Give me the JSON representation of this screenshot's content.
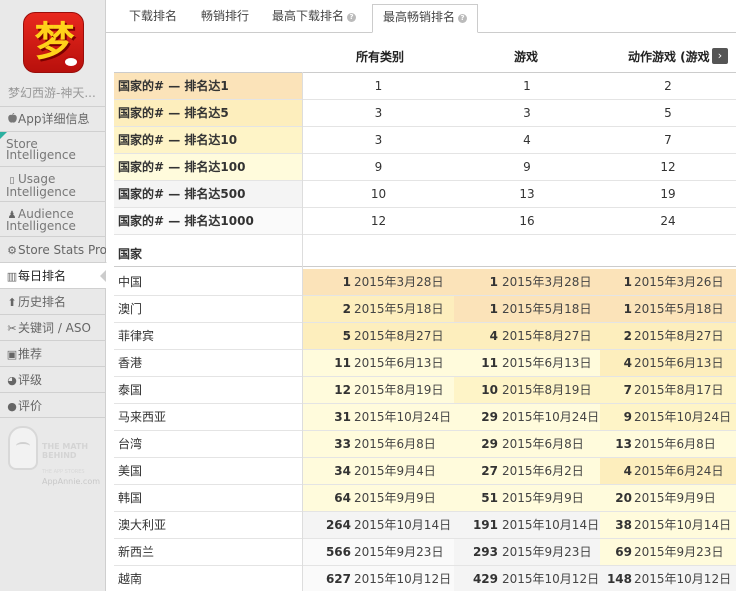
{
  "sidebar": {
    "app_name": "梦幻西游-神天...",
    "app_icon_glyph": "梦",
    "items": [
      {
        "label": "App详细信息",
        "icon": "apple-icon",
        "glyph": ""
      },
      {
        "label1": "Store",
        "label2": "Intelligence",
        "icon": "store-intelligence-icon"
      },
      {
        "label1": "Usage",
        "label2": "Intelligence",
        "icon": "usage-intelligence-icon",
        "glyph": "▯"
      },
      {
        "label1": "Audience",
        "label2": "Intelligence",
        "icon": "audience-intelligence-icon",
        "glyph": "♟"
      },
      {
        "label": "Store Stats Pro",
        "icon": "gear-icon",
        "glyph": "⚙"
      },
      {
        "label": "每日排名",
        "icon": "bar-chart-icon",
        "glyph": "▥"
      },
      {
        "label": "历史排名",
        "icon": "arrow-up-icon",
        "glyph": "⬆"
      },
      {
        "label": "关键词 / ASO",
        "icon": "wrench-icon",
        "glyph": "✂"
      },
      {
        "label": "推荐",
        "icon": "featured-icon",
        "glyph": "▣"
      },
      {
        "label": "评级",
        "icon": "rating-icon",
        "glyph": "◕"
      },
      {
        "label": "评价",
        "icon": "reviews-icon",
        "glyph": "●"
      }
    ],
    "logo": {
      "line1": "THE MATH",
      "line2": "BEHIND",
      "small": "THE APP STORES",
      "brand": "AppAnnie.com"
    }
  },
  "tabs": [
    {
      "label": "下载排名",
      "help": false
    },
    {
      "label": "畅销排行",
      "help": false
    },
    {
      "label": "最高下载排名",
      "help": true
    },
    {
      "label": "最高畅销排名",
      "help": true,
      "active": true
    }
  ],
  "table": {
    "columns": [
      "所有类别",
      "游戏",
      "动作游戏 (游戏"
    ],
    "scroll_glyph": "›",
    "summary_rows": [
      {
        "label": "国家的# — 排名达1",
        "values": [
          "1",
          "1",
          "2"
        ]
      },
      {
        "label": "国家的# — 排名达5",
        "values": [
          "3",
          "3",
          "5"
        ]
      },
      {
        "label": "国家的# — 排名达10",
        "values": [
          "3",
          "4",
          "7"
        ]
      },
      {
        "label": "国家的# — 排名达100",
        "values": [
          "9",
          "9",
          "12"
        ]
      },
      {
        "label": "国家的# — 排名达500",
        "values": [
          "10",
          "13",
          "19"
        ]
      },
      {
        "label": "国家的# — 排名达1000",
        "values": [
          "12",
          "16",
          "24"
        ]
      }
    ],
    "country_header": "国家",
    "countries": [
      {
        "name": "中国",
        "cells": [
          [
            "1",
            "2015年3月28日"
          ],
          [
            "1",
            "2015年3月28日"
          ],
          [
            "1",
            "2015年3月26日"
          ]
        ]
      },
      {
        "name": "澳门",
        "cells": [
          [
            "2",
            "2015年5月18日"
          ],
          [
            "1",
            "2015年5月18日"
          ],
          [
            "1",
            "2015年5月18日"
          ]
        ]
      },
      {
        "name": "菲律宾",
        "cells": [
          [
            "5",
            "2015年8月27日"
          ],
          [
            "4",
            "2015年8月27日"
          ],
          [
            "2",
            "2015年8月27日"
          ]
        ]
      },
      {
        "name": "香港",
        "cells": [
          [
            "11",
            "2015年6月13日"
          ],
          [
            "11",
            "2015年6月13日"
          ],
          [
            "4",
            "2015年6月13日"
          ]
        ]
      },
      {
        "name": "泰国",
        "cells": [
          [
            "12",
            "2015年8月19日"
          ],
          [
            "10",
            "2015年8月19日"
          ],
          [
            "7",
            "2015年8月17日"
          ]
        ]
      },
      {
        "name": "马来西亚",
        "cells": [
          [
            "31",
            "2015年10月24日"
          ],
          [
            "29",
            "2015年10月24日"
          ],
          [
            "9",
            "2015年10月24日"
          ]
        ]
      },
      {
        "name": "台湾",
        "cells": [
          [
            "33",
            "2015年6月8日"
          ],
          [
            "29",
            "2015年6月8日"
          ],
          [
            "13",
            "2015年6月8日"
          ]
        ]
      },
      {
        "name": "美国",
        "cells": [
          [
            "34",
            "2015年9月4日"
          ],
          [
            "27",
            "2015年6月2日"
          ],
          [
            "4",
            "2015年6月24日"
          ]
        ]
      },
      {
        "name": "韩国",
        "cells": [
          [
            "64",
            "2015年9月9日"
          ],
          [
            "51",
            "2015年9月9日"
          ],
          [
            "20",
            "2015年9月9日"
          ]
        ]
      },
      {
        "name": "澳大利亚",
        "cells": [
          [
            "264",
            "2015年10月14日"
          ],
          [
            "191",
            "2015年10月14日"
          ],
          [
            "38",
            "2015年10月14日"
          ]
        ]
      },
      {
        "name": "新西兰",
        "cells": [
          [
            "566",
            "2015年9月23日"
          ],
          [
            "293",
            "2015年9月23日"
          ],
          [
            "69",
            "2015年9月23日"
          ]
        ]
      },
      {
        "name": "越南",
        "cells": [
          [
            "627",
            "2015年10月12日"
          ],
          [
            "429",
            "2015年10月12日"
          ],
          [
            "148",
            "2015年10月12日"
          ]
        ]
      }
    ]
  },
  "colors": {
    "rank_1": "#fbe3b9",
    "rank_top5": "#fdeebd",
    "rank_top10": "#fef4c7",
    "rank_top100": "#fffbdc",
    "rank_top500": "#f4f4f4",
    "rank_top1000": "#fafafa",
    "accent": "#2bb0a0"
  }
}
